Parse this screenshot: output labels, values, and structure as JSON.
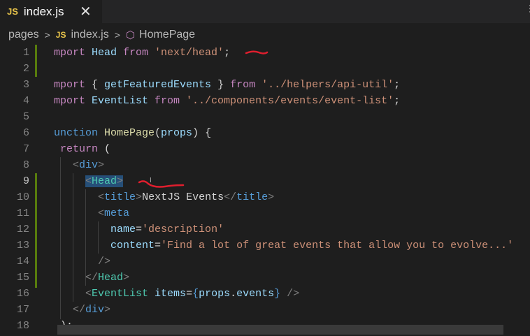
{
  "tab": {
    "badge": "JS",
    "filename": "index.js",
    "close_glyph": "✕"
  },
  "breadcrumb": {
    "folder": "pages",
    "file_badge": "JS",
    "file": "index.js",
    "symbol": "HomePage"
  },
  "colors": {
    "background": "#1e1e1e",
    "keyword": "#c586c0",
    "string": "#ce9178",
    "tag": "#569cd6",
    "component": "#4ec9b0",
    "annotation": "#e01e2e"
  },
  "editor": {
    "active_line": "9",
    "lines": [
      {
        "num": "1",
        "tokens": [
          {
            "t": "mport ",
            "c": "kw"
          },
          {
            "t": "Head ",
            "c": "id"
          },
          {
            "t": "from ",
            "c": "kw"
          },
          {
            "t": "'next/head'",
            "c": "str"
          },
          {
            "t": ";",
            "c": ""
          }
        ]
      },
      {
        "num": "2",
        "tokens": []
      },
      {
        "num": "3",
        "tokens": [
          {
            "t": "mport ",
            "c": "kw"
          },
          {
            "t": "{ ",
            "c": ""
          },
          {
            "t": "getFeaturedEvents",
            "c": "id"
          },
          {
            "t": " } ",
            "c": ""
          },
          {
            "t": "from ",
            "c": "kw"
          },
          {
            "t": "'../helpers/api-util'",
            "c": "str"
          },
          {
            "t": ";",
            "c": ""
          }
        ]
      },
      {
        "num": "4",
        "tokens": [
          {
            "t": "mport ",
            "c": "kw"
          },
          {
            "t": "EventList ",
            "c": "id"
          },
          {
            "t": "from ",
            "c": "kw"
          },
          {
            "t": "'../components/events/event-list'",
            "c": "str"
          },
          {
            "t": ";",
            "c": ""
          }
        ]
      },
      {
        "num": "5",
        "tokens": []
      },
      {
        "num": "6",
        "tokens": [
          {
            "t": "unction ",
            "c": "tag"
          },
          {
            "t": "HomePage",
            "c": "fn"
          },
          {
            "t": "(",
            "c": ""
          },
          {
            "t": "props",
            "c": "id"
          },
          {
            "t": ") {",
            "c": ""
          }
        ]
      },
      {
        "num": "7",
        "tokens": [
          {
            "t": " return ",
            "c": "kw"
          },
          {
            "t": "(",
            "c": ""
          }
        ]
      },
      {
        "num": "8",
        "tokens": [
          {
            "t": "   ",
            "c": ""
          },
          {
            "t": "<",
            "c": "punc"
          },
          {
            "t": "div",
            "c": "tag"
          },
          {
            "t": ">",
            "c": "punc"
          }
        ]
      },
      {
        "num": "9",
        "tokens": [
          {
            "t": "     ",
            "c": ""
          },
          {
            "t": "<",
            "c": "punc sel"
          },
          {
            "t": "Head",
            "c": "comp sel"
          },
          {
            "t": ">",
            "c": "punc sel"
          }
        ]
      },
      {
        "num": "10",
        "tokens": [
          {
            "t": "       ",
            "c": ""
          },
          {
            "t": "<",
            "c": "punc"
          },
          {
            "t": "title",
            "c": "tag"
          },
          {
            "t": ">",
            "c": "punc"
          },
          {
            "t": "NextJS Events",
            "c": ""
          },
          {
            "t": "</",
            "c": "punc"
          },
          {
            "t": "title",
            "c": "tag"
          },
          {
            "t": ">",
            "c": "punc"
          }
        ]
      },
      {
        "num": "11",
        "tokens": [
          {
            "t": "       ",
            "c": ""
          },
          {
            "t": "<",
            "c": "punc"
          },
          {
            "t": "meta",
            "c": "tag"
          }
        ]
      },
      {
        "num": "12",
        "tokens": [
          {
            "t": "         ",
            "c": ""
          },
          {
            "t": "name",
            "c": "attr"
          },
          {
            "t": "=",
            "c": ""
          },
          {
            "t": "'description'",
            "c": "str"
          }
        ]
      },
      {
        "num": "13",
        "tokens": [
          {
            "t": "         ",
            "c": ""
          },
          {
            "t": "content",
            "c": "attr"
          },
          {
            "t": "=",
            "c": ""
          },
          {
            "t": "'Find a lot of great events that allow you to evolve...'",
            "c": "str"
          }
        ]
      },
      {
        "num": "14",
        "tokens": [
          {
            "t": "       ",
            "c": ""
          },
          {
            "t": "/>",
            "c": "punc"
          }
        ]
      },
      {
        "num": "15",
        "tokens": [
          {
            "t": "     ",
            "c": ""
          },
          {
            "t": "</",
            "c": "punc"
          },
          {
            "t": "Head",
            "c": "comp"
          },
          {
            "t": ">",
            "c": "punc"
          }
        ]
      },
      {
        "num": "16",
        "tokens": [
          {
            "t": "     ",
            "c": ""
          },
          {
            "t": "<",
            "c": "punc"
          },
          {
            "t": "EventList ",
            "c": "comp"
          },
          {
            "t": "items",
            "c": "attr"
          },
          {
            "t": "=",
            "c": ""
          },
          {
            "t": "{",
            "c": "tag"
          },
          {
            "t": "props",
            "c": "id"
          },
          {
            "t": ".",
            "c": ""
          },
          {
            "t": "events",
            "c": "id"
          },
          {
            "t": "}",
            "c": "tag"
          },
          {
            "t": " />",
            "c": "punc"
          }
        ]
      },
      {
        "num": "17",
        "tokens": [
          {
            "t": "   ",
            "c": ""
          },
          {
            "t": "</",
            "c": "punc"
          },
          {
            "t": "div",
            "c": "tag"
          },
          {
            "t": ">",
            "c": "punc"
          }
        ]
      },
      {
        "num": "18",
        "tokens": [
          {
            "t": " );",
            "c": ""
          }
        ]
      }
    ]
  }
}
